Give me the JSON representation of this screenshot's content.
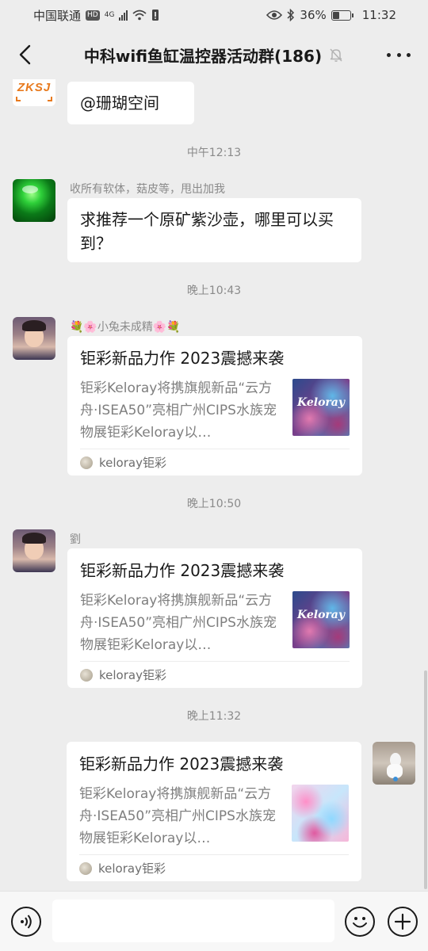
{
  "status_bar": {
    "carrier": "中国联通",
    "hd": "HD",
    "network": "4G",
    "battery": "36%",
    "battery_level": 0.36,
    "time": "11:32"
  },
  "header": {
    "title": "中科wifi鱼缸温控器活动群(186)"
  },
  "messages": [
    {
      "avatar_text": "ZKSJ",
      "text": "@珊瑚空间"
    },
    {
      "time": "中午12:13"
    },
    {
      "sender": "收所有软体，菇皮等，甩出加我",
      "text": "求推荐一个原矿紫沙壶，哪里可以买到？"
    },
    {
      "time": "晚上10:43"
    },
    {
      "sender": "💐🌸小兔未成精🌸💐",
      "card": {
        "title": "钜彩新品力作 2023震撼来袭",
        "desc": "钜彩Keloray将携旗舰新品“云方舟·ISEA50”亮相广州CIPS水族宠物展钜彩Keloray以…",
        "thumb_text": "Keloray",
        "source": "keloray钜彩"
      }
    },
    {
      "time": "晚上10:50"
    },
    {
      "sender": "劉",
      "card": {
        "title": "钜彩新品力作 2023震撼来袭",
        "desc": "钜彩Keloray将携旗舰新品“云方舟·ISEA50”亮相广州CIPS水族宠物展钜彩Keloray以…",
        "thumb_text": "Keloray",
        "source": "keloray钜彩"
      }
    },
    {
      "time": "晚上11:32"
    },
    {
      "card": {
        "title": "钜彩新品力作 2023震撼来袭",
        "desc": "钜彩Keloray将携旗舰新品“云方舟·ISEA50”亮相广州CIPS水族宠物展钜彩Keloray以…",
        "source": "keloray钜彩"
      }
    }
  ],
  "input_bar": {
    "value": ""
  },
  "icons": [
    "back-arrow-icon",
    "mute-bell-icon",
    "more-icon",
    "voice-icon",
    "emoji-icon",
    "plus-icon"
  ]
}
